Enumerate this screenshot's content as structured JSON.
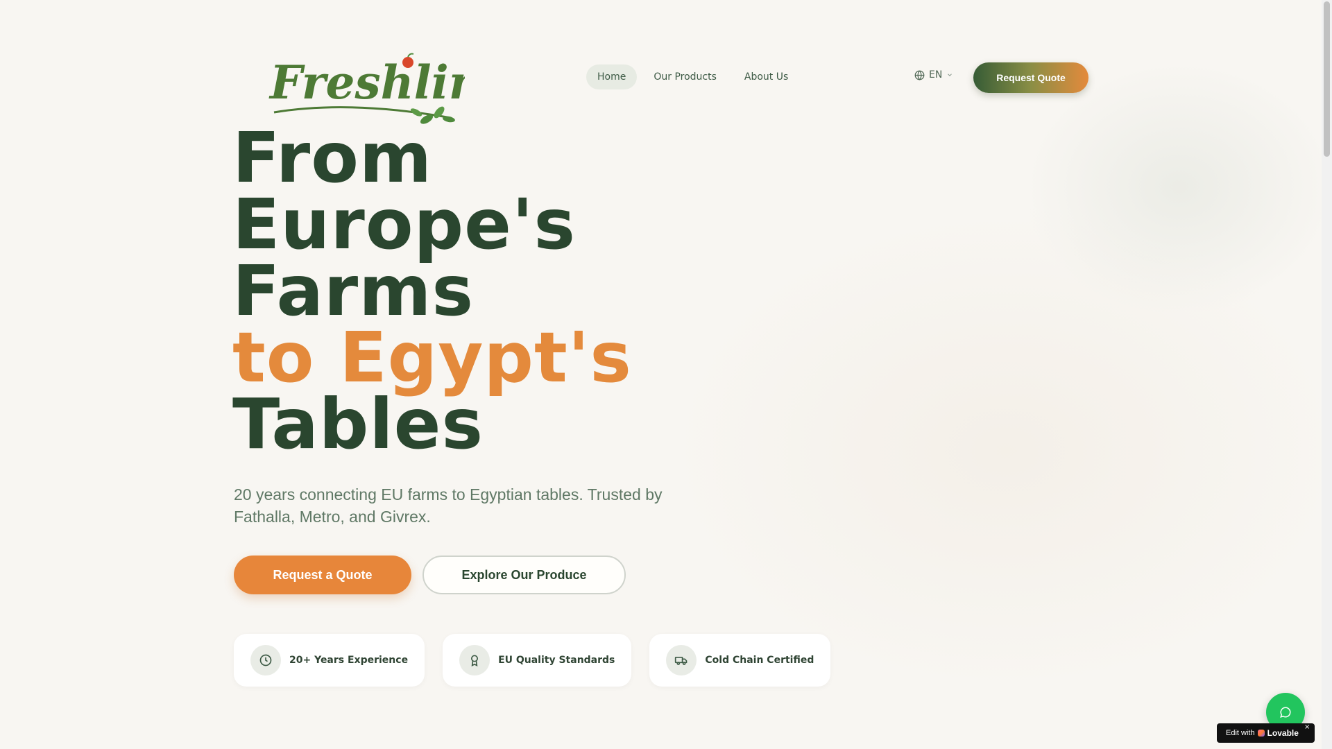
{
  "header": {
    "logo": {
      "text": "Freshline",
      "colors": {
        "letters": "#4d7a35",
        "fruit": "#d9472b",
        "leaves": "#4f8a3c"
      }
    },
    "nav": [
      {
        "label": "Home",
        "active": true
      },
      {
        "label": "Our Products",
        "active": false
      },
      {
        "label": "About Us",
        "active": false
      }
    ],
    "language": {
      "label": "EN",
      "icon": "globe-icon",
      "caret_icon": "chevron-down-icon"
    },
    "cta_label": "Request Quote"
  },
  "hero": {
    "title_lines": [
      "From",
      "Europe's",
      "Farms"
    ],
    "title_accent": "to Egypt's",
    "title_last": "Tables",
    "subtitle": "20 years connecting EU farms to Egyptian tables. Trusted by Fathalla, Metro, and Givrex.",
    "primary_button": "Request a Quote",
    "secondary_button": "Explore Our Produce",
    "badges": [
      {
        "label": "20+ Years Experience",
        "icon": "clock-icon"
      },
      {
        "label": "EU Quality Standards",
        "icon": "award-icon"
      },
      {
        "label": "Cold Chain Certified",
        "icon": "truck-icon"
      }
    ]
  },
  "widgets": {
    "chat_icon": "chat-bubble-icon",
    "lovable_badge": {
      "prefix": "Edit with",
      "brand": "Lovable",
      "close": "×"
    }
  },
  "colors": {
    "primary_dark": "#2a462f",
    "accent_orange": "#e48a3c",
    "background": "#f8f6f2",
    "chat_green": "#22c55e"
  }
}
